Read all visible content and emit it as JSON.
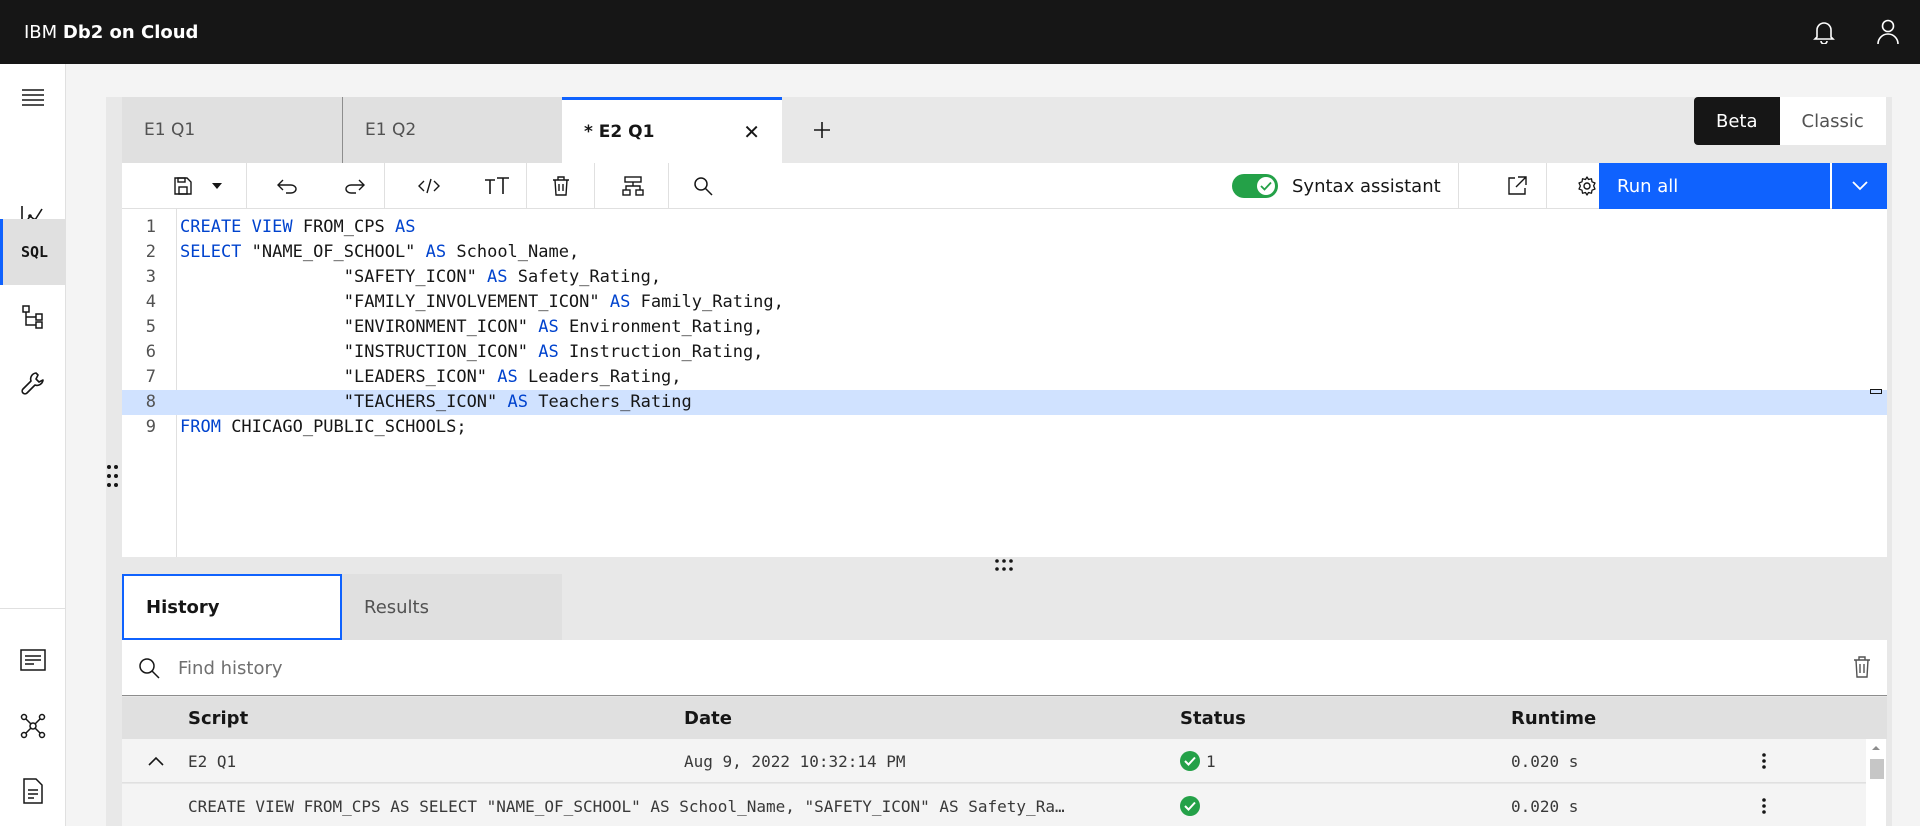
{
  "app": {
    "brand_prefix": "IBM ",
    "brand_name": "Db2 on Cloud"
  },
  "header": {
    "icons": [
      "notification-icon",
      "user-icon"
    ]
  },
  "rail": {
    "items": [
      {
        "icon": "menu-icon"
      },
      {
        "icon": "chart-icon"
      },
      {
        "label": "SQL",
        "active": true
      },
      {
        "icon": "schema-tree-icon"
      },
      {
        "icon": "wrench-icon"
      },
      {
        "icon": "console-icon"
      },
      {
        "icon": "network-icon"
      },
      {
        "icon": "document-icon"
      }
    ]
  },
  "tabs": [
    {
      "label": "E1 Q1"
    },
    {
      "label": "E1 Q2"
    },
    {
      "label": "* E2 Q1",
      "active": true
    }
  ],
  "mode": {
    "beta": "Beta",
    "classic": "Classic"
  },
  "toolbar": {
    "syntax_label": "Syntax assistant",
    "run_label": "Run all"
  },
  "editor": {
    "lines": [
      {
        "n": "1",
        "parts": [
          [
            "kw",
            "CREATE VIEW"
          ],
          [
            "t",
            " FROM_CPS "
          ],
          [
            "kw",
            "AS"
          ]
        ]
      },
      {
        "n": "2",
        "parts": [
          [
            "kw",
            "SELECT"
          ],
          [
            "t",
            " \"NAME_OF_SCHOOL\" "
          ],
          [
            "kw",
            "AS"
          ],
          [
            "t",
            " School_Name,"
          ]
        ]
      },
      {
        "n": "3",
        "parts": [
          [
            "t",
            "                \"SAFETY_ICON\" "
          ],
          [
            "kw",
            "AS"
          ],
          [
            "t",
            " Safety_Rating,"
          ]
        ]
      },
      {
        "n": "4",
        "parts": [
          [
            "t",
            "                \"FAMILY_INVOLVEMENT_ICON\" "
          ],
          [
            "kw",
            "AS"
          ],
          [
            "t",
            " Family_Rating,"
          ]
        ]
      },
      {
        "n": "5",
        "parts": [
          [
            "t",
            "                \"ENVIRONMENT_ICON\" "
          ],
          [
            "kw",
            "AS"
          ],
          [
            "t",
            " Environment_Rating,"
          ]
        ]
      },
      {
        "n": "6",
        "parts": [
          [
            "t",
            "                \"INSTRUCTION_ICON\" "
          ],
          [
            "kw",
            "AS"
          ],
          [
            "t",
            " Instruction_Rating,"
          ]
        ]
      },
      {
        "n": "7",
        "parts": [
          [
            "t",
            "                \"LEADERS_ICON\" "
          ],
          [
            "kw",
            "AS"
          ],
          [
            "t",
            " Leaders_Rating,"
          ]
        ]
      },
      {
        "n": "8",
        "hl": true,
        "parts": [
          [
            "t",
            "                \"TEACHERS_ICON\" "
          ],
          [
            "kw",
            "AS"
          ],
          [
            "t",
            " Teachers_Rating"
          ]
        ]
      },
      {
        "n": "9",
        "parts": [
          [
            "kw",
            "FROM"
          ],
          [
            "t",
            " CHICAGO_PUBLIC_SCHOOLS;"
          ]
        ]
      }
    ]
  },
  "bottom_tabs": {
    "history": "History",
    "results": "Results"
  },
  "history": {
    "search_placeholder": "Find history",
    "columns": {
      "script": "Script",
      "date": "Date",
      "status": "Status",
      "runtime": "Runtime"
    },
    "rows": [
      {
        "script": "E2 Q1",
        "date": "Aug 9, 2022 10:32:14 PM",
        "status": "1",
        "runtime": "0.020 s"
      },
      {
        "script": "CREATE VIEW FROM_CPS AS SELECT \"NAME_OF_SCHOOL\" AS School_Name, \"SAFETY_ICON\" AS Safety_Ra…",
        "date": "",
        "status": "",
        "runtime": "0.020 s"
      }
    ]
  },
  "colors": {
    "accent": "#0f62fe",
    "success": "#24a148",
    "header_bg": "#161616",
    "keyword": "#0043ce",
    "highlight": "#d0e2ff"
  }
}
